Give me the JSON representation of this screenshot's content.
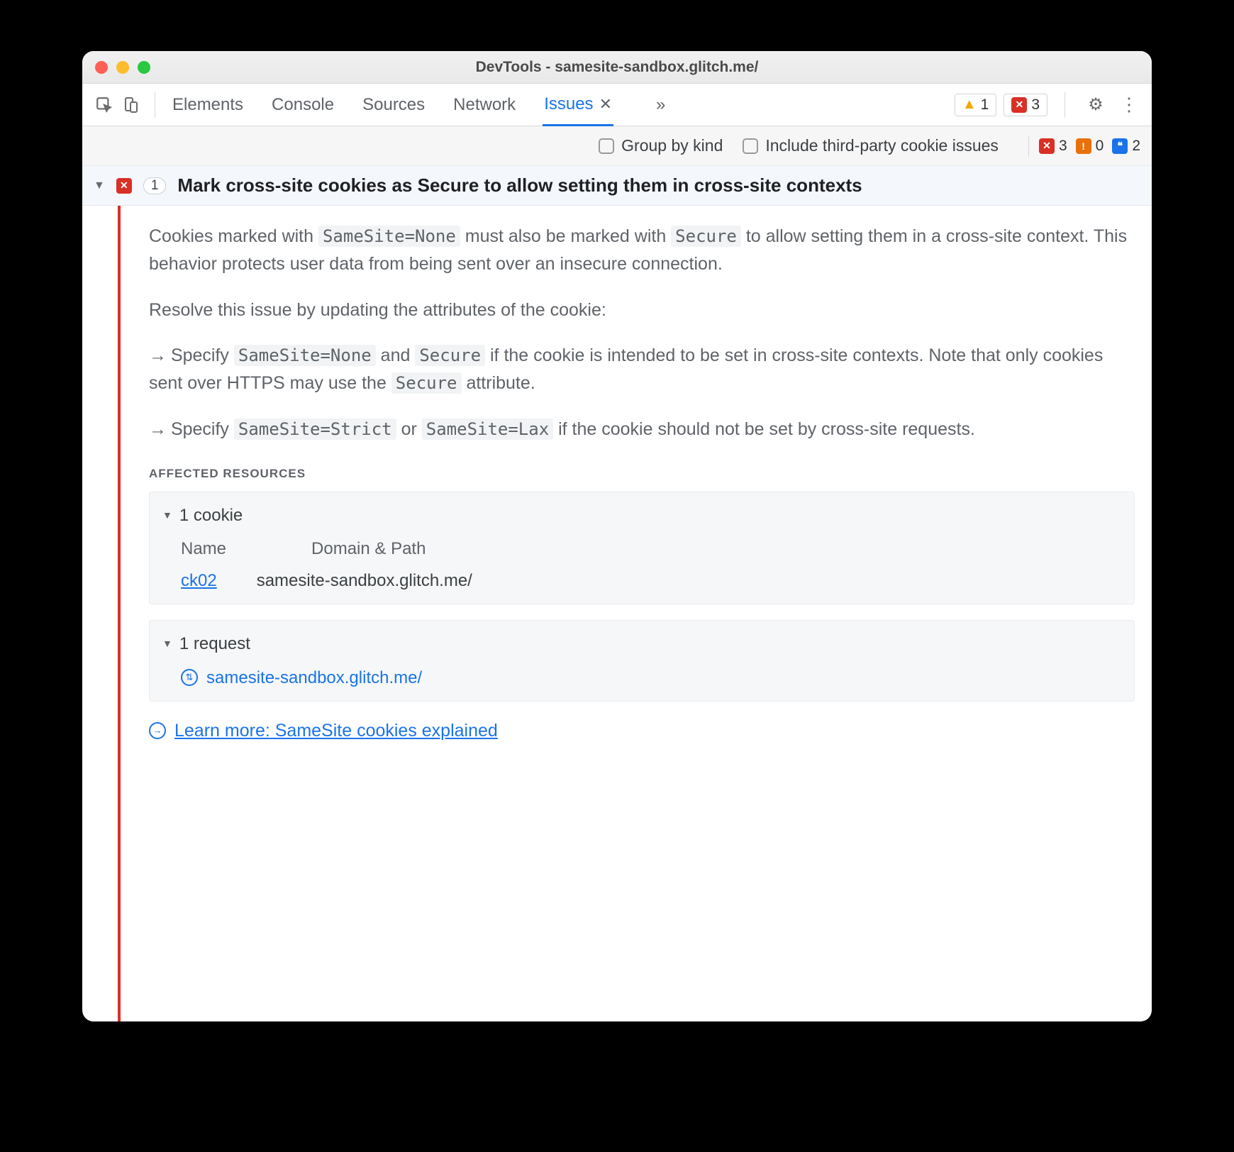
{
  "window": {
    "title": "DevTools - samesite-sandbox.glitch.me/"
  },
  "tabs": {
    "items": [
      "Elements",
      "Console",
      "Sources",
      "Network",
      "Issues"
    ],
    "active": "Issues"
  },
  "toolbar_right": {
    "warnings": "1",
    "errors": "3"
  },
  "filterbar": {
    "group_by_kind": "Group by kind",
    "include_third_party": "Include third-party cookie issues",
    "counts": {
      "errors": "3",
      "warnings_orange": "0",
      "info_blue": "2"
    }
  },
  "issue": {
    "count": "1",
    "title": "Mark cross-site cookies as Secure to allow setting them in cross-site contexts",
    "desc": {
      "p1a": "Cookies marked with ",
      "code1": "SameSite=None",
      "p1b": " must also be marked with ",
      "code2": "Secure",
      "p1c": " to allow setting them in a cross-site context. This behavior protects user data from being sent over an insecure connection.",
      "p2": "Resolve this issue by updating the attributes of the cookie:",
      "b1a": "Specify ",
      "b1code1": "SameSite=None",
      "b1b": " and ",
      "b1code2": "Secure",
      "b1c": " if the cookie is intended to be set in cross-site contexts. Note that only cookies sent over HTTPS may use the ",
      "b1code3": "Secure",
      "b1d": " attribute.",
      "b2a": "Specify ",
      "b2code1": "SameSite=Strict",
      "b2b": " or ",
      "b2code2": "SameSite=Lax",
      "b2c": " if the cookie should not be set by cross-site requests."
    },
    "affected": {
      "label": "AFFECTED RESOURCES",
      "cookies": {
        "header": "1 cookie",
        "col1": "Name",
        "col2": "Domain & Path",
        "row": {
          "name": "ck02",
          "domain": "samesite-sandbox.glitch.me/"
        }
      },
      "requests": {
        "header": "1 request",
        "url": "samesite-sandbox.glitch.me/"
      }
    },
    "learn_more": "Learn more: SameSite cookies explained"
  }
}
